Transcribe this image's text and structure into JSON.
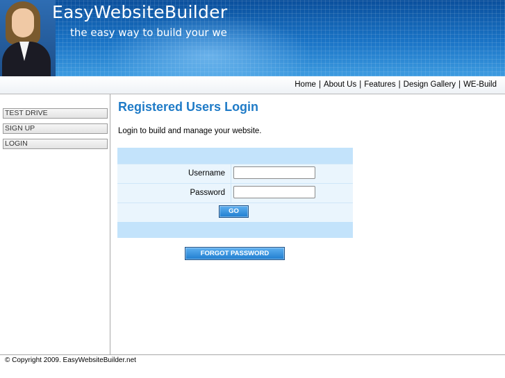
{
  "banner": {
    "title": "EasyWebsiteBuilder",
    "tagline": "the easy way to build your we"
  },
  "topnav": {
    "items": [
      "Home",
      "About Us",
      "Features",
      "Design Gallery",
      "WE-Build"
    ],
    "separator": "|"
  },
  "sidebar": {
    "items": [
      "TEST DRIVE",
      "SIGN UP",
      "LOGIN"
    ]
  },
  "main": {
    "title": "Registered Users Login",
    "intro": "Login to build and manage your website.",
    "username_label": "Username",
    "password_label": "Password",
    "username_value": "",
    "password_value": "",
    "go_label": "GO",
    "forgot_label": "FORGOT PASSWORD"
  },
  "footer": {
    "copyright": "© Copyright 2009. EasyWebsiteBuilder.net"
  },
  "colors": {
    "accent": "#1f7bc7",
    "button": "#1f7ed0",
    "panel": "#c3e3fb",
    "banner": "#1a74c6"
  }
}
